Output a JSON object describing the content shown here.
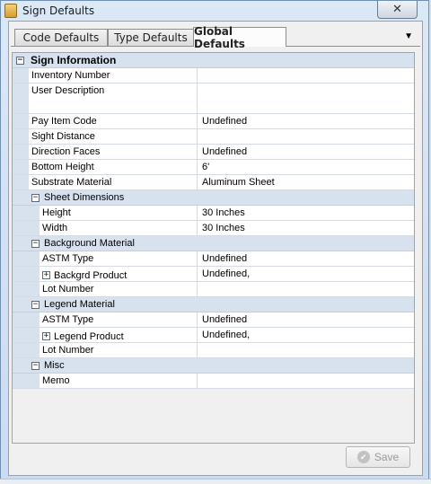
{
  "window": {
    "title": "Sign Defaults",
    "close_label": "✕"
  },
  "tabs": [
    {
      "label": "Code Defaults"
    },
    {
      "label": "Type Defaults"
    },
    {
      "label": "Global Defaults"
    }
  ],
  "tab_dropdown_icon": "▼",
  "grid": {
    "category": "Sign Information",
    "toggle_minus": "−",
    "toggle_plus": "+",
    "rows": {
      "inventory_number": {
        "name": "Inventory Number",
        "value": ""
      },
      "user_description": {
        "name": "User Description",
        "value": ""
      },
      "pay_item_code": {
        "name": "Pay Item Code",
        "value": "Undefined"
      },
      "sight_distance": {
        "name": "Sight Distance",
        "value": ""
      },
      "direction_faces": {
        "name": "Direction Faces",
        "value": "Undefined"
      },
      "bottom_height": {
        "name": "Bottom Height",
        "value": "6'"
      },
      "substrate_material": {
        "name": "Substrate Material",
        "value": "Aluminum Sheet"
      }
    },
    "sheet_dimensions": {
      "label": "Sheet Dimensions",
      "height": {
        "name": "Height",
        "value": "30 Inches"
      },
      "width": {
        "name": "Width",
        "value": "30 Inches"
      }
    },
    "background_material": {
      "label": "Background Material",
      "astm_type": {
        "name": "ASTM Type",
        "value": "Undefined"
      },
      "product": {
        "name": "Backgrd Product",
        "value": "Undefined,"
      },
      "lot_number": {
        "name": "Lot Number",
        "value": ""
      }
    },
    "legend_material": {
      "label": "Legend Material",
      "astm_type": {
        "name": "ASTM Type",
        "value": "Undefined"
      },
      "product": {
        "name": "Legend Product",
        "value": "Undefined,"
      },
      "lot_number": {
        "name": "Lot Number",
        "value": ""
      }
    },
    "misc": {
      "label": "Misc",
      "memo": {
        "name": "Memo",
        "value": ""
      }
    }
  },
  "save_button": {
    "label": "Save",
    "enabled": false,
    "icon": "check-circle-icon"
  }
}
